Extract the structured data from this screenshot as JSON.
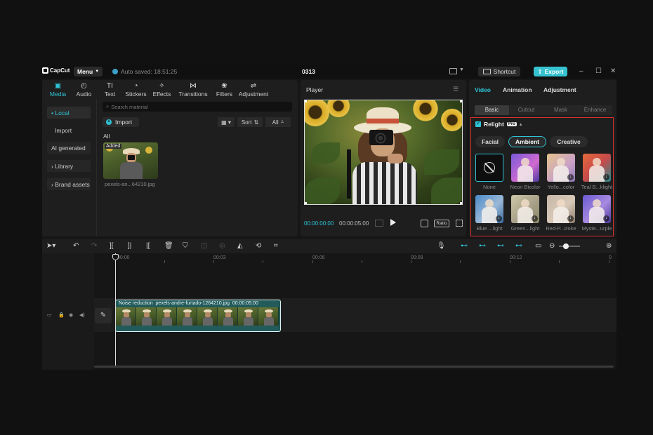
{
  "titlebar": {
    "logo": "CapCut",
    "menu": "Menu",
    "autosave": "Auto saved: 18:51:25",
    "project": "0313",
    "shortcut": "Shortcut",
    "export": "Export"
  },
  "media_tabs": [
    {
      "label": "Media",
      "icon": "▣"
    },
    {
      "label": "Audio",
      "icon": "◴"
    },
    {
      "label": "Text",
      "icon": "TI"
    },
    {
      "label": "Stickers",
      "icon": "◔"
    },
    {
      "label": "Effects",
      "icon": "✧"
    },
    {
      "label": "Transitions",
      "icon": "⋈"
    },
    {
      "label": "Filters",
      "icon": "❀"
    },
    {
      "label": "Adjustment",
      "icon": "⇌"
    }
  ],
  "media_sidebar": [
    "• Local",
    "Import",
    "AI generated",
    "› Library",
    "› Brand assets"
  ],
  "media": {
    "search_placeholder": "Search material",
    "import": "Import",
    "sort": "Sort",
    "all_filter": "All",
    "all_label": "All",
    "thumb_badge": "Added",
    "thumb_name": "pexels-an...64210.jpg"
  },
  "player": {
    "title": "Player",
    "time_current": "00:00:00:00",
    "time_total": "00:00:05:00",
    "ratio": "Ratio"
  },
  "right_panel": {
    "tabs": [
      "Video",
      "Animation",
      "Adjustment"
    ],
    "subtabs": [
      "Basic",
      "Cutout",
      "Mask",
      "Enhance"
    ],
    "relight": {
      "title": "Relight",
      "badge": "Pro",
      "modes": [
        "Facial",
        "Ambient",
        "Creative"
      ],
      "presets": [
        {
          "label": "None"
        },
        {
          "label": "Neon Bicolor"
        },
        {
          "label": "Yello...color"
        },
        {
          "label": "Teal B...klight"
        },
        {
          "label": "Blue ...light"
        },
        {
          "label": "Green...light"
        },
        {
          "label": "Red-P...troke"
        },
        {
          "label": "Myste...urple"
        }
      ]
    }
  },
  "timeline": {
    "ruler": [
      "00:00",
      "00:03",
      "00:06",
      "00:09",
      "00:12",
      "0"
    ],
    "clip": {
      "effect": "Noise reduction",
      "filename": "pexels-andre-furtado-1264210.jpg",
      "duration": "00:00:05:00"
    }
  },
  "colors": {
    "accent": "#2fc4d6",
    "highlight_border": "#d8302c",
    "background": "#1e1e1e"
  }
}
